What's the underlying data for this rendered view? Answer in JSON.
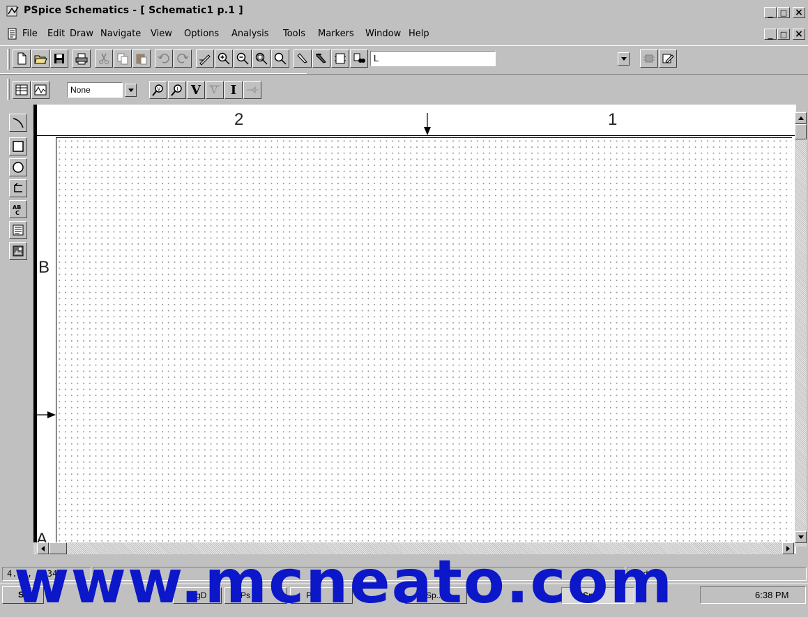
{
  "window": {
    "title": "PSpice Schematics - [ Schematic1  p.1  ]",
    "min_label": "_",
    "max_label": "□",
    "close_label": "×"
  },
  "menu": [
    "File",
    "Edit",
    "Draw",
    "Navigate",
    "View",
    "Options",
    "Analysis",
    "Tools",
    "Markers",
    "Window",
    "Help"
  ],
  "toolbar": {
    "part_combo_value": "L",
    "marker_combo_value": "None",
    "v_marker_label": "V",
    "i_marker_label": "I"
  },
  "sheet": {
    "col_labels": [
      "2",
      "1"
    ],
    "row_labels": [
      "B",
      "A"
    ]
  },
  "status": {
    "coords": "4.67, 4.34",
    "cmd_label": "Cmd:"
  },
  "taskbar": {
    "items": [
      "St",
      "",
      "",
      "FigD",
      "",
      "Ps",
      "Ps",
      "PSp...",
      "PSpic",
      "",
      ""
    ],
    "clock": "6:38 PM"
  },
  "watermark": "www.mcneato.com",
  "colors": {
    "watermark": "#0b17c8",
    "grid_dot": "#9a9a9a",
    "chrome": "#c0c0c0"
  }
}
